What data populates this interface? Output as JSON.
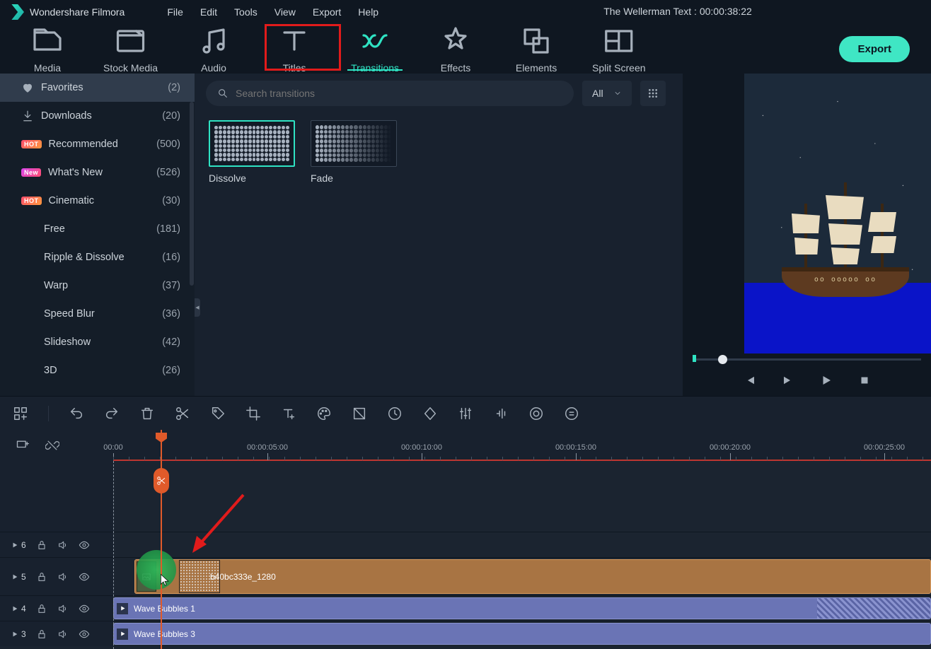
{
  "app": {
    "name": "Wondershare Filmora",
    "project_title": "The Wellerman Text : 00:00:38:22"
  },
  "menu": [
    "File",
    "Edit",
    "Tools",
    "View",
    "Export",
    "Help"
  ],
  "ribbon": [
    {
      "id": "media",
      "label": "Media"
    },
    {
      "id": "stock",
      "label": "Stock Media"
    },
    {
      "id": "audio",
      "label": "Audio"
    },
    {
      "id": "titles",
      "label": "Titles"
    },
    {
      "id": "transitions",
      "label": "Transitions",
      "active": true
    },
    {
      "id": "effects",
      "label": "Effects"
    },
    {
      "id": "elements",
      "label": "Elements"
    },
    {
      "id": "split",
      "label": "Split Screen"
    }
  ],
  "export_btn": "Export",
  "search": {
    "placeholder": "Search transitions",
    "filter": "All"
  },
  "sidebar": [
    {
      "icon": "heart",
      "label": "Favorites",
      "count": "(2)",
      "selected": true
    },
    {
      "icon": "download",
      "label": "Downloads",
      "count": "(20)"
    },
    {
      "badge": "HOT",
      "label": "Recommended",
      "count": "(500)"
    },
    {
      "badge": "New",
      "label": "What's New",
      "count": "(526)"
    },
    {
      "badge": "HOT",
      "label": "Cinematic",
      "count": "(30)"
    },
    {
      "sub": true,
      "label": "Free",
      "count": "(181)"
    },
    {
      "sub": true,
      "label": "Ripple & Dissolve",
      "count": "(16)"
    },
    {
      "sub": true,
      "label": "Warp",
      "count": "(37)"
    },
    {
      "sub": true,
      "label": "Speed Blur",
      "count": "(36)"
    },
    {
      "sub": true,
      "label": "Slideshow",
      "count": "(42)"
    },
    {
      "sub": true,
      "label": "3D",
      "count": "(26)"
    }
  ],
  "thumbs": [
    {
      "label": "Dissolve",
      "selected": true,
      "variant": "solid"
    },
    {
      "label": "Fade",
      "variant": "fade"
    }
  ],
  "ruler": {
    "ticks": [
      {
        "pos": 0,
        "label": "00:00"
      },
      {
        "pos": 218,
        "label": "00:00:05:00"
      },
      {
        "pos": 436,
        "label": "00:00:10:00"
      },
      {
        "pos": 654,
        "label": "00:00:15:00"
      },
      {
        "pos": 872,
        "label": "00:00:20:00"
      },
      {
        "pos": 1090,
        "label": "00:00:25:00"
      }
    ]
  },
  "tracks": {
    "image_clip": "b40bc333e_1280",
    "wave1": "Wave Bubbles 1",
    "wave3": "Wave Bubbles 3"
  },
  "track_nums": [
    "6",
    "5",
    "4",
    "3"
  ]
}
